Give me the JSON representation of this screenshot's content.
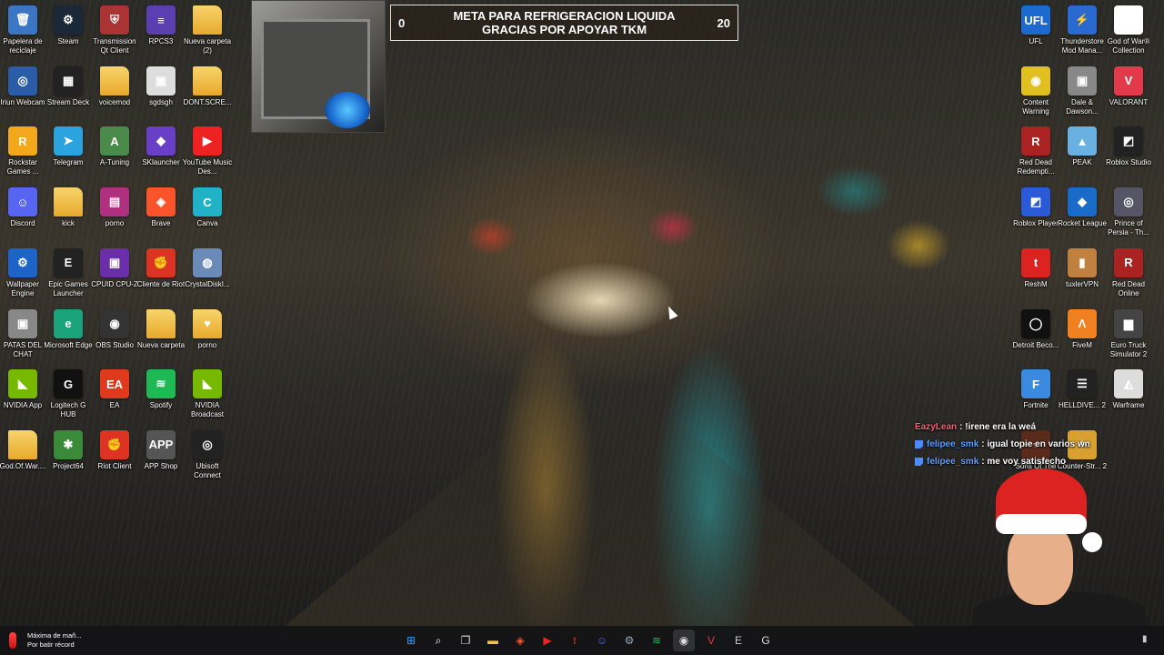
{
  "stream_goal": {
    "current": "0",
    "title": "META PARA REFRIGERACION LIQUIDA GRACIAS POR APOYAR TKM",
    "target": "20"
  },
  "desktop_left_icons": [
    {
      "label": "Papelera de reciclaje",
      "icon": "recycle-bin-icon",
      "color": "#3a76c4",
      "glyph": "🗑"
    },
    {
      "label": "Steam",
      "icon": "steam-icon",
      "color": "#1b2838",
      "glyph": "⚙"
    },
    {
      "label": "Transmission Qt Client",
      "icon": "transmission-icon",
      "color": "#a33",
      "glyph": "⛨"
    },
    {
      "label": "RPCS3",
      "icon": "rpcs3-icon",
      "color": "#5b3fb0",
      "glyph": "≡"
    },
    {
      "label": "Nueva carpeta (2)",
      "icon": "folder-icon",
      "color": "#f2c14b",
      "glyph": ""
    },
    {
      "label": "Iriun Webcam",
      "icon": "iriun-icon",
      "color": "#2b5ca8",
      "glyph": "◎"
    },
    {
      "label": "Stream Deck",
      "icon": "stream-deck-icon",
      "color": "#222",
      "glyph": "▦"
    },
    {
      "label": "voicemod",
      "icon": "folder-icon",
      "color": "#f2c14b",
      "glyph": ""
    },
    {
      "label": "sgdsgh",
      "icon": "image-file-icon",
      "color": "#ddd",
      "glyph": "▣"
    },
    {
      "label": "DONT.SCRE...",
      "icon": "folder-icon",
      "color": "#f2c14b",
      "glyph": ""
    },
    {
      "label": "Rockstar Games ...",
      "icon": "rockstar-icon",
      "color": "#f3a81b",
      "glyph": "R"
    },
    {
      "label": "Telegram",
      "icon": "telegram-icon",
      "color": "#2aa3df",
      "glyph": "➤"
    },
    {
      "label": "A-Tuning",
      "icon": "a-tuning-icon",
      "color": "#4a8a4a",
      "glyph": "A"
    },
    {
      "label": "SKlauncher",
      "icon": "sklauncher-icon",
      "color": "#6a3fc8",
      "glyph": "◆"
    },
    {
      "label": "YouTube Music Des...",
      "icon": "youtube-music-icon",
      "color": "#e22",
      "glyph": "▶"
    },
    {
      "label": "Discord",
      "icon": "discord-icon",
      "color": "#5865f2",
      "glyph": "☺"
    },
    {
      "label": "kick",
      "icon": "folder-icon",
      "color": "#f2c14b",
      "glyph": ""
    },
    {
      "label": "porno",
      "icon": "winrar-icon",
      "color": "#b03080",
      "glyph": "▤"
    },
    {
      "label": "Brave",
      "icon": "brave-icon",
      "color": "#fb542b",
      "glyph": "◈"
    },
    {
      "label": "Canva",
      "icon": "canva-icon",
      "color": "#20b3c8",
      "glyph": "C"
    },
    {
      "label": "Wallpaper Engine",
      "icon": "wallpaper-engine-icon",
      "color": "#1d63c8",
      "glyph": "⚙"
    },
    {
      "label": "Epic Games Launcher",
      "icon": "epic-games-icon",
      "color": "#222",
      "glyph": "E"
    },
    {
      "label": "CPUID CPU-Z",
      "icon": "cpu-z-icon",
      "color": "#6a2fa8",
      "glyph": "▣"
    },
    {
      "label": "Cliente de Riot",
      "icon": "riot-icon",
      "color": "#d32",
      "glyph": "✊"
    },
    {
      "label": "CrystalDiskI...",
      "icon": "crystaldisk-icon",
      "color": "#6a8ab8",
      "glyph": "◍"
    },
    {
      "label": "PATAS DEL CHAT",
      "icon": "image-file-icon",
      "color": "#888",
      "glyph": "▣"
    },
    {
      "label": "Microsoft Edge",
      "icon": "edge-icon",
      "color": "#1aa37a",
      "glyph": "e"
    },
    {
      "label": "OBS Studio",
      "icon": "obs-icon",
      "color": "#333",
      "glyph": "◉"
    },
    {
      "label": "Nueva carpeta",
      "icon": "folder-icon",
      "color": "#f2c14b",
      "glyph": ""
    },
    {
      "label": "porno",
      "icon": "folder-icon",
      "color": "#e8a030",
      "glyph": "♥"
    },
    {
      "label": "NVIDIA App",
      "icon": "nvidia-icon",
      "color": "#76b900",
      "glyph": "◣"
    },
    {
      "label": "Logitech G HUB",
      "icon": "logitech-icon",
      "color": "#111",
      "glyph": "G"
    },
    {
      "label": "EA",
      "icon": "ea-icon",
      "color": "#e03a1e",
      "glyph": "EA"
    },
    {
      "label": "Spotify",
      "icon": "spotify-icon",
      "color": "#1db954",
      "glyph": "≋"
    },
    {
      "label": "NVIDIA Broadcast",
      "icon": "nvidia-broadcast-icon",
      "color": "#76b900",
      "glyph": "◣"
    },
    {
      "label": "God.Of.War....",
      "icon": "folder-icon",
      "color": "#f2c14b",
      "glyph": ""
    },
    {
      "label": "Project64",
      "icon": "project64-icon",
      "color": "#3a8a3a",
      "glyph": "✱"
    },
    {
      "label": "Riot Client",
      "icon": "riot-client-icon",
      "color": "#d32",
      "glyph": "✊"
    },
    {
      "label": "APP Shop",
      "icon": "app-shop-icon",
      "color": "#555",
      "glyph": "APP"
    },
    {
      "label": "Ubisoft Connect",
      "icon": "ubisoft-icon",
      "color": "#222",
      "glyph": "◎"
    }
  ],
  "desktop_right_icons": [
    {
      "label": "UFL",
      "icon": "ufl-icon",
      "color": "#1a6ad0",
      "glyph": "UFL"
    },
    {
      "label": "Thunderstore Mod Mana...",
      "icon": "thunderstore-icon",
      "color": "#2a6ad0",
      "glyph": "⚡"
    },
    {
      "label": "God of War® Collection",
      "icon": "blank-file-icon",
      "color": "#fff",
      "glyph": ""
    },
    {
      "label": "Content Warning",
      "icon": "content-warning-icon",
      "color": "#e0c020",
      "glyph": "◉"
    },
    {
      "label": "Dale & Dawson...",
      "icon": "dale-dawson-icon",
      "color": "#888",
      "glyph": "▣"
    },
    {
      "label": "VALORANT",
      "icon": "valorant-icon",
      "color": "#e23a4a",
      "glyph": "V"
    },
    {
      "label": "Red Dead Redempti...",
      "icon": "red-dead-icon",
      "color": "#a22",
      "glyph": "R"
    },
    {
      "label": "PEAK",
      "icon": "peak-icon",
      "color": "#6ab0e0",
      "glyph": "▲"
    },
    {
      "label": "Roblox Studio",
      "icon": "roblox-studio-icon",
      "color": "#222",
      "glyph": "◩"
    },
    {
      "label": "Roblox Player",
      "icon": "roblox-player-icon",
      "color": "#2a5ad8",
      "glyph": "◩"
    },
    {
      "label": "Rocket League",
      "icon": "rocket-league-icon",
      "color": "#1a6ac8",
      "glyph": "◆"
    },
    {
      "label": "Prince of Persia - Th...",
      "icon": "prince-of-persia-icon",
      "color": "#556",
      "glyph": "◎"
    },
    {
      "label": "ReshM",
      "icon": "reshm-icon",
      "color": "#d22",
      "glyph": "t"
    },
    {
      "label": "tuxlerVPN",
      "icon": "tuxlervpn-icon",
      "color": "#c08040",
      "glyph": "▮"
    },
    {
      "label": "Red Dead Online",
      "icon": "red-dead-online-icon",
      "color": "#a22",
      "glyph": "R"
    },
    {
      "label": "Detroit Beco...",
      "icon": "detroit-icon",
      "color": "#111",
      "glyph": "◯"
    },
    {
      "label": "FiveM",
      "icon": "fivem-icon",
      "color": "#f08020",
      "glyph": "Λ"
    },
    {
      "label": "Euro Truck Simulator 2",
      "icon": "euro-truck-icon",
      "color": "#444",
      "glyph": "▆"
    },
    {
      "label": "Fortnite",
      "icon": "fortnite-icon",
      "color": "#3a8ae0",
      "glyph": "F"
    },
    {
      "label": "HELLDIVE... 2",
      "icon": "helldivers-icon",
      "color": "#222",
      "glyph": "☰"
    },
    {
      "label": "Warframe",
      "icon": "warframe-icon",
      "color": "#ddd",
      "glyph": "◭"
    },
    {
      "label": "Sons Of The Forest",
      "icon": "sons-forest-icon",
      "color": "#5a2a1a",
      "glyph": "♆"
    },
    {
      "label": "Counter-Str... 2",
      "icon": "counter-strike-icon",
      "color": "#d8a030",
      "glyph": "✦"
    }
  ],
  "chat": [
    {
      "user": "EazyLean",
      "user_color": "#ff5a7a",
      "sep": ":",
      "message": "!irene era la weá",
      "badge": false
    },
    {
      "user": "felipee_smk",
      "user_color": "#5aa0ff",
      "sep": ":",
      "message": "igual topie en varios wn",
      "badge": true
    },
    {
      "user": "felipee_smk",
      "user_color": "#5aa0ff",
      "sep": ":",
      "message": "me voy satisfecho",
      "badge": true
    }
  ],
  "taskbar": {
    "weather_line1": "Máxima de mañ...",
    "weather_line2": "Por batir récord",
    "apps": [
      {
        "name": "windows-start-icon",
        "glyph": "⊞",
        "color": "#3aa0ff"
      },
      {
        "name": "search-icon",
        "glyph": "⌕",
        "color": "#fff"
      },
      {
        "name": "task-view-icon",
        "glyph": "❐",
        "color": "#ddd"
      },
      {
        "name": "file-explorer-icon",
        "glyph": "▬",
        "color": "#f2c14b"
      },
      {
        "name": "brave-icon",
        "glyph": "◈",
        "color": "#fb542b"
      },
      {
        "name": "youtube-music-icon",
        "glyph": "▶",
        "color": "#e22"
      },
      {
        "name": "tiktok-app-icon",
        "glyph": "t",
        "color": "#e22"
      },
      {
        "name": "discord-icon",
        "glyph": "☺",
        "color": "#5865f2"
      },
      {
        "name": "steam-icon",
        "glyph": "⚙",
        "color": "#9ab"
      },
      {
        "name": "spotify-icon",
        "glyph": "≋",
        "color": "#1db954"
      },
      {
        "name": "obs-icon",
        "glyph": "◉",
        "color": "#ddd"
      },
      {
        "name": "valorant-icon",
        "glyph": "V",
        "color": "#e23a4a"
      },
      {
        "name": "epic-games-icon",
        "glyph": "E",
        "color": "#ccc"
      },
      {
        "name": "logitech-icon",
        "glyph": "G",
        "color": "#ddd"
      }
    ]
  }
}
